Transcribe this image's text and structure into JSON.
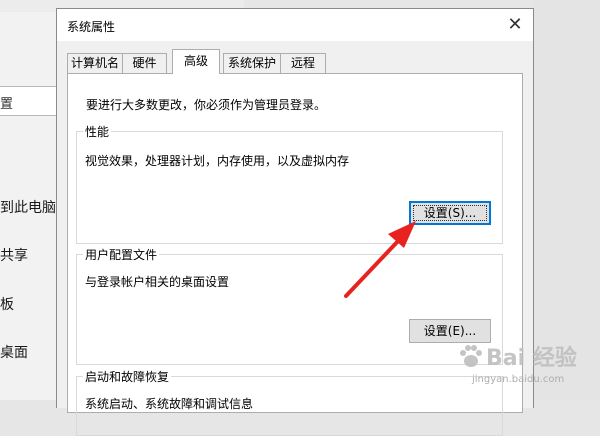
{
  "background_window": {
    "search_fragment": "置",
    "items": [
      "到此电脑",
      "共享",
      "板",
      "桌面"
    ]
  },
  "dialog": {
    "title": "系统属性",
    "close_icon": "close-icon",
    "tabs": [
      {
        "label": "计算机名",
        "active": false
      },
      {
        "label": "硬件",
        "active": false
      },
      {
        "label": "高级",
        "active": true
      },
      {
        "label": "系统保护",
        "active": false
      },
      {
        "label": "远程",
        "active": false
      }
    ],
    "admin_notice": "要进行大多数更改，你必须作为管理员登录。",
    "performance": {
      "label": "性能",
      "description": "视觉效果，处理器计划，内存使用，以及虚拟内存",
      "button": "设置(S)..."
    },
    "user_profiles": {
      "label": "用户配置文件",
      "description": "与登录帐户相关的桌面设置",
      "button": "设置(E)..."
    },
    "startup_recovery": {
      "label": "启动和故障恢复",
      "description": "系统启动、系统故障和调试信息"
    }
  },
  "annotation": {
    "arrow_color": "#e8231f"
  },
  "watermark": {
    "brand": "Bai 经验",
    "url": "jingyan.baidu.com"
  }
}
